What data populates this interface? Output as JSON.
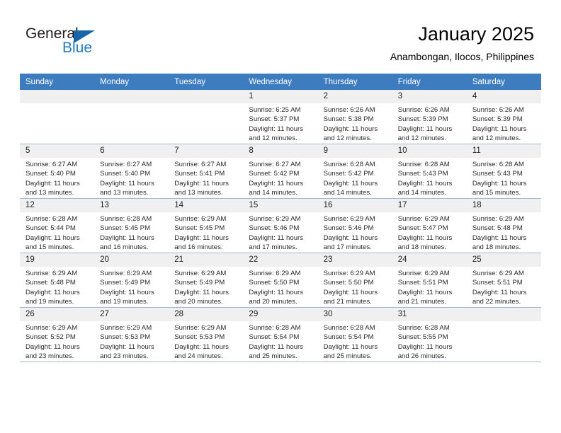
{
  "brand": {
    "name_part1": "General",
    "name_part2": "Blue",
    "triangle_color": "#1565a8",
    "blue_color": "#1f7ac4"
  },
  "header": {
    "title": "January 2025",
    "subtitle": "Anambongan, Ilocos, Philippines"
  },
  "theme": {
    "header_row_bg": "#3d7dbf",
    "daynum_bg": "#f0f0f0",
    "grid_line": "#9fb8d4"
  },
  "weekday_headers": [
    "Sunday",
    "Monday",
    "Tuesday",
    "Wednesday",
    "Thursday",
    "Friday",
    "Saturday"
  ],
  "weeks": [
    [
      {
        "day": "",
        "sunrise": "",
        "sunset": "",
        "daylight1": "",
        "daylight2": ""
      },
      {
        "day": "",
        "sunrise": "",
        "sunset": "",
        "daylight1": "",
        "daylight2": ""
      },
      {
        "day": "",
        "sunrise": "",
        "sunset": "",
        "daylight1": "",
        "daylight2": ""
      },
      {
        "day": "1",
        "sunrise": "Sunrise: 6:25 AM",
        "sunset": "Sunset: 5:37 PM",
        "daylight1": "Daylight: 11 hours",
        "daylight2": "and 12 minutes."
      },
      {
        "day": "2",
        "sunrise": "Sunrise: 6:26 AM",
        "sunset": "Sunset: 5:38 PM",
        "daylight1": "Daylight: 11 hours",
        "daylight2": "and 12 minutes."
      },
      {
        "day": "3",
        "sunrise": "Sunrise: 6:26 AM",
        "sunset": "Sunset: 5:39 PM",
        "daylight1": "Daylight: 11 hours",
        "daylight2": "and 12 minutes."
      },
      {
        "day": "4",
        "sunrise": "Sunrise: 6:26 AM",
        "sunset": "Sunset: 5:39 PM",
        "daylight1": "Daylight: 11 hours",
        "daylight2": "and 12 minutes."
      }
    ],
    [
      {
        "day": "5",
        "sunrise": "Sunrise: 6:27 AM",
        "sunset": "Sunset: 5:40 PM",
        "daylight1": "Daylight: 11 hours",
        "daylight2": "and 13 minutes."
      },
      {
        "day": "6",
        "sunrise": "Sunrise: 6:27 AM",
        "sunset": "Sunset: 5:40 PM",
        "daylight1": "Daylight: 11 hours",
        "daylight2": "and 13 minutes."
      },
      {
        "day": "7",
        "sunrise": "Sunrise: 6:27 AM",
        "sunset": "Sunset: 5:41 PM",
        "daylight1": "Daylight: 11 hours",
        "daylight2": "and 13 minutes."
      },
      {
        "day": "8",
        "sunrise": "Sunrise: 6:27 AM",
        "sunset": "Sunset: 5:42 PM",
        "daylight1": "Daylight: 11 hours",
        "daylight2": "and 14 minutes."
      },
      {
        "day": "9",
        "sunrise": "Sunrise: 6:28 AM",
        "sunset": "Sunset: 5:42 PM",
        "daylight1": "Daylight: 11 hours",
        "daylight2": "and 14 minutes."
      },
      {
        "day": "10",
        "sunrise": "Sunrise: 6:28 AM",
        "sunset": "Sunset: 5:43 PM",
        "daylight1": "Daylight: 11 hours",
        "daylight2": "and 14 minutes."
      },
      {
        "day": "11",
        "sunrise": "Sunrise: 6:28 AM",
        "sunset": "Sunset: 5:43 PM",
        "daylight1": "Daylight: 11 hours",
        "daylight2": "and 15 minutes."
      }
    ],
    [
      {
        "day": "12",
        "sunrise": "Sunrise: 6:28 AM",
        "sunset": "Sunset: 5:44 PM",
        "daylight1": "Daylight: 11 hours",
        "daylight2": "and 15 minutes."
      },
      {
        "day": "13",
        "sunrise": "Sunrise: 6:28 AM",
        "sunset": "Sunset: 5:45 PM",
        "daylight1": "Daylight: 11 hours",
        "daylight2": "and 16 minutes."
      },
      {
        "day": "14",
        "sunrise": "Sunrise: 6:29 AM",
        "sunset": "Sunset: 5:45 PM",
        "daylight1": "Daylight: 11 hours",
        "daylight2": "and 16 minutes."
      },
      {
        "day": "15",
        "sunrise": "Sunrise: 6:29 AM",
        "sunset": "Sunset: 5:46 PM",
        "daylight1": "Daylight: 11 hours",
        "daylight2": "and 17 minutes."
      },
      {
        "day": "16",
        "sunrise": "Sunrise: 6:29 AM",
        "sunset": "Sunset: 5:46 PM",
        "daylight1": "Daylight: 11 hours",
        "daylight2": "and 17 minutes."
      },
      {
        "day": "17",
        "sunrise": "Sunrise: 6:29 AM",
        "sunset": "Sunset: 5:47 PM",
        "daylight1": "Daylight: 11 hours",
        "daylight2": "and 18 minutes."
      },
      {
        "day": "18",
        "sunrise": "Sunrise: 6:29 AM",
        "sunset": "Sunset: 5:48 PM",
        "daylight1": "Daylight: 11 hours",
        "daylight2": "and 18 minutes."
      }
    ],
    [
      {
        "day": "19",
        "sunrise": "Sunrise: 6:29 AM",
        "sunset": "Sunset: 5:48 PM",
        "daylight1": "Daylight: 11 hours",
        "daylight2": "and 19 minutes."
      },
      {
        "day": "20",
        "sunrise": "Sunrise: 6:29 AM",
        "sunset": "Sunset: 5:49 PM",
        "daylight1": "Daylight: 11 hours",
        "daylight2": "and 19 minutes."
      },
      {
        "day": "21",
        "sunrise": "Sunrise: 6:29 AM",
        "sunset": "Sunset: 5:49 PM",
        "daylight1": "Daylight: 11 hours",
        "daylight2": "and 20 minutes."
      },
      {
        "day": "22",
        "sunrise": "Sunrise: 6:29 AM",
        "sunset": "Sunset: 5:50 PM",
        "daylight1": "Daylight: 11 hours",
        "daylight2": "and 20 minutes."
      },
      {
        "day": "23",
        "sunrise": "Sunrise: 6:29 AM",
        "sunset": "Sunset: 5:50 PM",
        "daylight1": "Daylight: 11 hours",
        "daylight2": "and 21 minutes."
      },
      {
        "day": "24",
        "sunrise": "Sunrise: 6:29 AM",
        "sunset": "Sunset: 5:51 PM",
        "daylight1": "Daylight: 11 hours",
        "daylight2": "and 21 minutes."
      },
      {
        "day": "25",
        "sunrise": "Sunrise: 6:29 AM",
        "sunset": "Sunset: 5:51 PM",
        "daylight1": "Daylight: 11 hours",
        "daylight2": "and 22 minutes."
      }
    ],
    [
      {
        "day": "26",
        "sunrise": "Sunrise: 6:29 AM",
        "sunset": "Sunset: 5:52 PM",
        "daylight1": "Daylight: 11 hours",
        "daylight2": "and 23 minutes."
      },
      {
        "day": "27",
        "sunrise": "Sunrise: 6:29 AM",
        "sunset": "Sunset: 5:53 PM",
        "daylight1": "Daylight: 11 hours",
        "daylight2": "and 23 minutes."
      },
      {
        "day": "28",
        "sunrise": "Sunrise: 6:29 AM",
        "sunset": "Sunset: 5:53 PM",
        "daylight1": "Daylight: 11 hours",
        "daylight2": "and 24 minutes."
      },
      {
        "day": "29",
        "sunrise": "Sunrise: 6:28 AM",
        "sunset": "Sunset: 5:54 PM",
        "daylight1": "Daylight: 11 hours",
        "daylight2": "and 25 minutes."
      },
      {
        "day": "30",
        "sunrise": "Sunrise: 6:28 AM",
        "sunset": "Sunset: 5:54 PM",
        "daylight1": "Daylight: 11 hours",
        "daylight2": "and 25 minutes."
      },
      {
        "day": "31",
        "sunrise": "Sunrise: 6:28 AM",
        "sunset": "Sunset: 5:55 PM",
        "daylight1": "Daylight: 11 hours",
        "daylight2": "and 26 minutes."
      },
      {
        "day": "",
        "sunrise": "",
        "sunset": "",
        "daylight1": "",
        "daylight2": ""
      }
    ]
  ]
}
